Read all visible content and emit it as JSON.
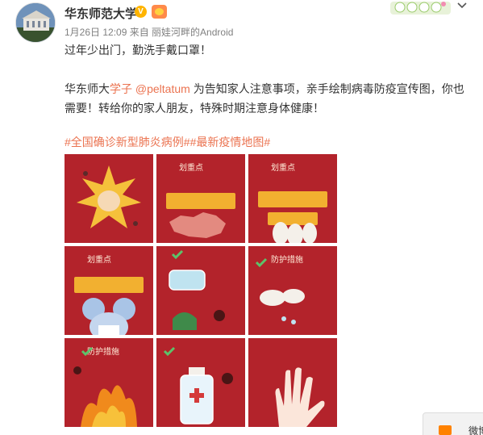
{
  "author": {
    "name": "华东师范大学",
    "verified_badge": "V",
    "meta": "1月26日 12:09 来自 丽娃河畔的Android"
  },
  "post": {
    "line1": "过年少出门，勤洗手戴口罩！",
    "para_prefix": "华东师大",
    "para_link1": "学子",
    "para_link2": "@peltatum",
    "para_rest": " 为告知家人注意事项，亲手绘制病毒防疫宣传图，你也需要！转给你的家人朋友，特殊时期注意身体健康！",
    "tags": "#全国确诊新型肺炎病例##最新疫情地图#"
  },
  "images": [
    {
      "caption": "",
      "pills": 0
    },
    {
      "caption": "划重点",
      "pills": 2
    },
    {
      "caption": "划重点",
      "pills": 2
    },
    {
      "caption": "划重点",
      "pills": 1
    },
    {
      "caption": "",
      "pills": 0
    },
    {
      "caption": "防护措施",
      "pills": 0
    },
    {
      "caption": "防护措施",
      "pills": 0
    },
    {
      "caption": "",
      "pills": 0
    },
    {
      "caption": "",
      "pills": 0
    }
  ],
  "colors": {
    "tile_red": "#b3232b",
    "accent_orange": "#eb7350",
    "pill_yellow": "#f2b030"
  },
  "float_tab": {
    "label": "微博"
  }
}
